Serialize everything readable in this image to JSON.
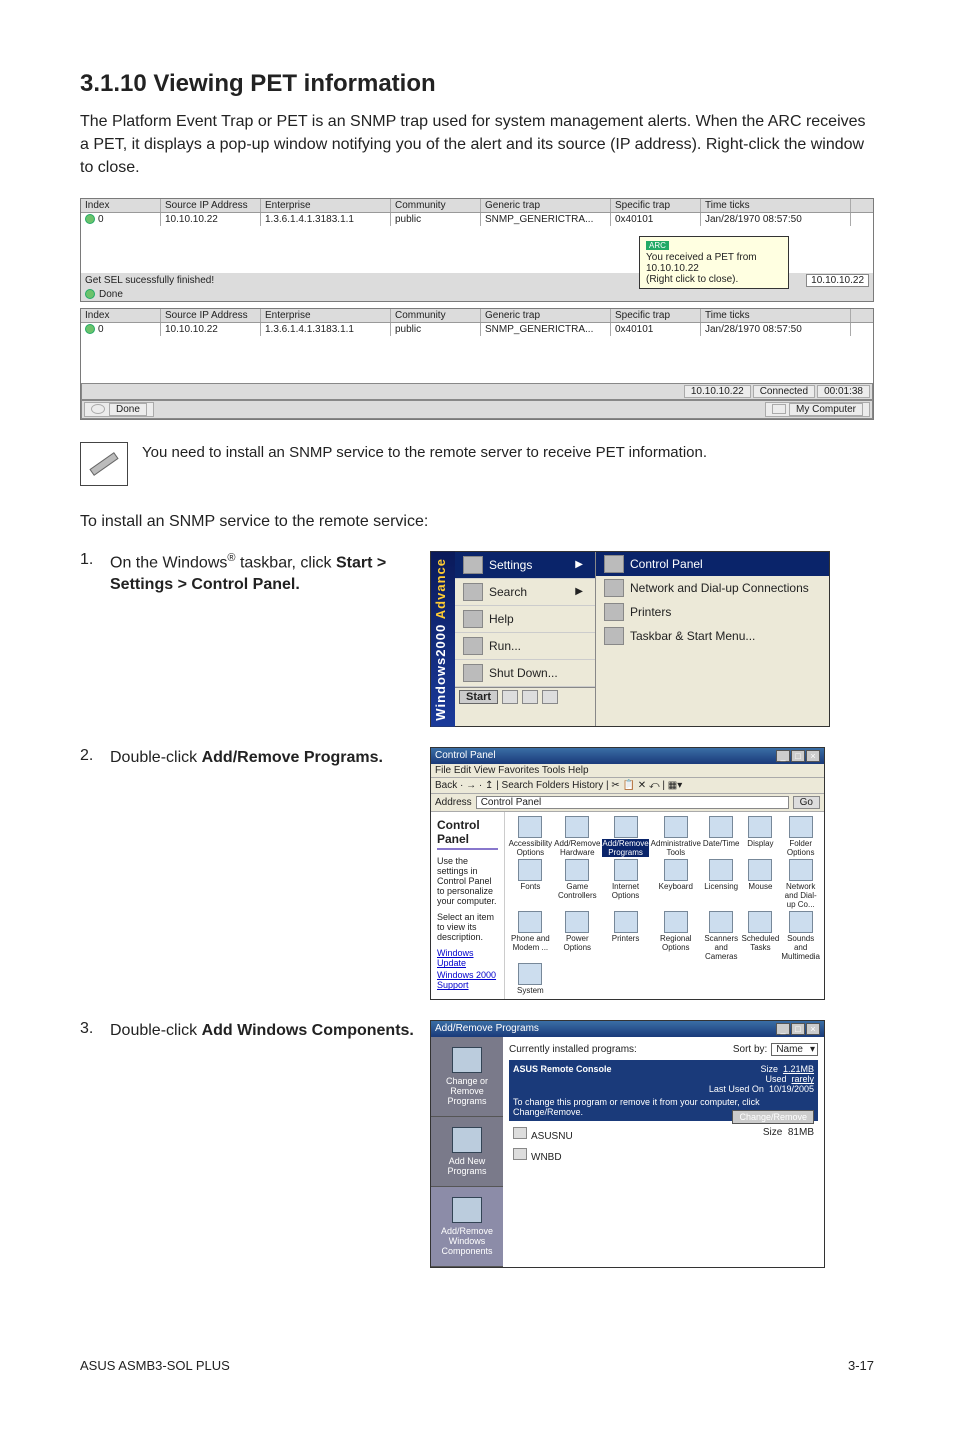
{
  "heading": "3.1.10    Viewing PET information",
  "intro": "The Platform Event Trap or PET is an SNMP trap used for system management alerts. When the ARC receives a PET, it displays a pop-up window notifying you of the alert and its source (IP address). Right-click the window to close.",
  "trap": {
    "headers": {
      "index": "Index",
      "ip": "Source IP Address",
      "ent": "Enterprise",
      "comm": "Community",
      "gen": "Generic trap",
      "spec": "Specific trap",
      "time": "Time ticks"
    },
    "row": {
      "index": "0",
      "ip": "10.10.10.22",
      "ent": "1.3.6.1.4.1.3183.1.1",
      "comm": "public",
      "gen": "SNMP_GENERICTRA...",
      "spec": "0x40101",
      "time": "Jan/28/1970 08:57:50"
    },
    "status_msg": "Get SEL sucessfully finished!",
    "status_ip": "10.10.10.22",
    "done": "Done",
    "tooltip_title": "ARC",
    "tooltip_l1": "You received a PET from 10.10.10.22",
    "tooltip_l2": "(Right click to close).",
    "connected": "Connected",
    "timecounter": "00:01:38",
    "mycomputer": "My Computer"
  },
  "note": "You need to install an SNMP service to the remote server to receive PET information.",
  "para2": "To install an SNMP service to the remote service:",
  "step1": {
    "num": "1.",
    "text_before": "On the Windows",
    "reg": "®",
    "text_mid": " taskbar, click ",
    "bold": "Start > Settings > Control Panel."
  },
  "startmenu": {
    "strip_a": "Windows",
    "strip_b": "2000",
    "strip_c": "Advance",
    "items": [
      "Settings",
      "Search",
      "Help",
      "Run...",
      "Shut Down..."
    ],
    "sub_head": "Control Panel",
    "sub_items": [
      "Network and Dial-up Connections",
      "Printers",
      "Taskbar & Start Menu..."
    ],
    "start": "Start"
  },
  "step2": {
    "num": "2.",
    "text": "Double-click ",
    "bold": "Add/Remove Programs."
  },
  "cp": {
    "title": "Control Panel",
    "menu": "File   Edit   View   Favorites   Tools   Help",
    "toolbar": "Back  ·  →  ·  ↥  |  Search   Folders   History  |  ✂  📋  ✕  ⤺  |  ▦▾",
    "addr_label": "Address",
    "addr_value": "Control Panel",
    "go": "Go",
    "left_hdr": "Control Panel",
    "left_desc": "Use the settings in Control Panel to personalize your computer.",
    "left_desc2": "Select an item to view its description.",
    "left_link1": "Windows Update",
    "left_link2": "Windows 2000 Support",
    "items": [
      "Accessibility Options",
      "Add/Remove Hardware",
      "Add/Remove Programs",
      "Administrative Tools",
      "Date/Time",
      "Display",
      "Folder Options",
      "Fonts",
      "Game Controllers",
      "Internet Options",
      "Keyboard",
      "Licensing",
      "Mouse",
      "Network and Dial-up Co...",
      "Phone and Modem ...",
      "Power Options",
      "Printers",
      "Regional Options",
      "Scanners and Cameras",
      "Scheduled Tasks",
      "Sounds and Multimedia",
      "System"
    ],
    "highlight_index": 2
  },
  "step3": {
    "num": "3.",
    "text": "Double-click ",
    "bold": "Add Windows Components."
  },
  "arp": {
    "title": "Add/Remove Programs",
    "tabs": [
      "Change or Remove Programs",
      "Add New Programs",
      "Add/Remove Windows Components"
    ],
    "current": "Currently installed programs:",
    "sortby": "Sort by:",
    "sortval": "Name",
    "sel_name": "ASUS Remote Console",
    "sel_size_l": "Size",
    "sel_size_v": "1.21MB",
    "sel_used_l": "Used",
    "sel_used_v": "rarely",
    "sel_last_l": "Last Used On",
    "sel_last_v": "10/19/2005",
    "sel_hint": "To change this program or remove it from your computer, click Change/Remove.",
    "btn": "Change/Remove",
    "plain": [
      {
        "name": "ASUSNU",
        "size": "Size",
        "val": "81MB"
      },
      {
        "name": "WNBD",
        "size": "",
        "val": ""
      }
    ]
  },
  "footer_left": "ASUS ASMB3-SOL PLUS",
  "footer_right": "3-17"
}
